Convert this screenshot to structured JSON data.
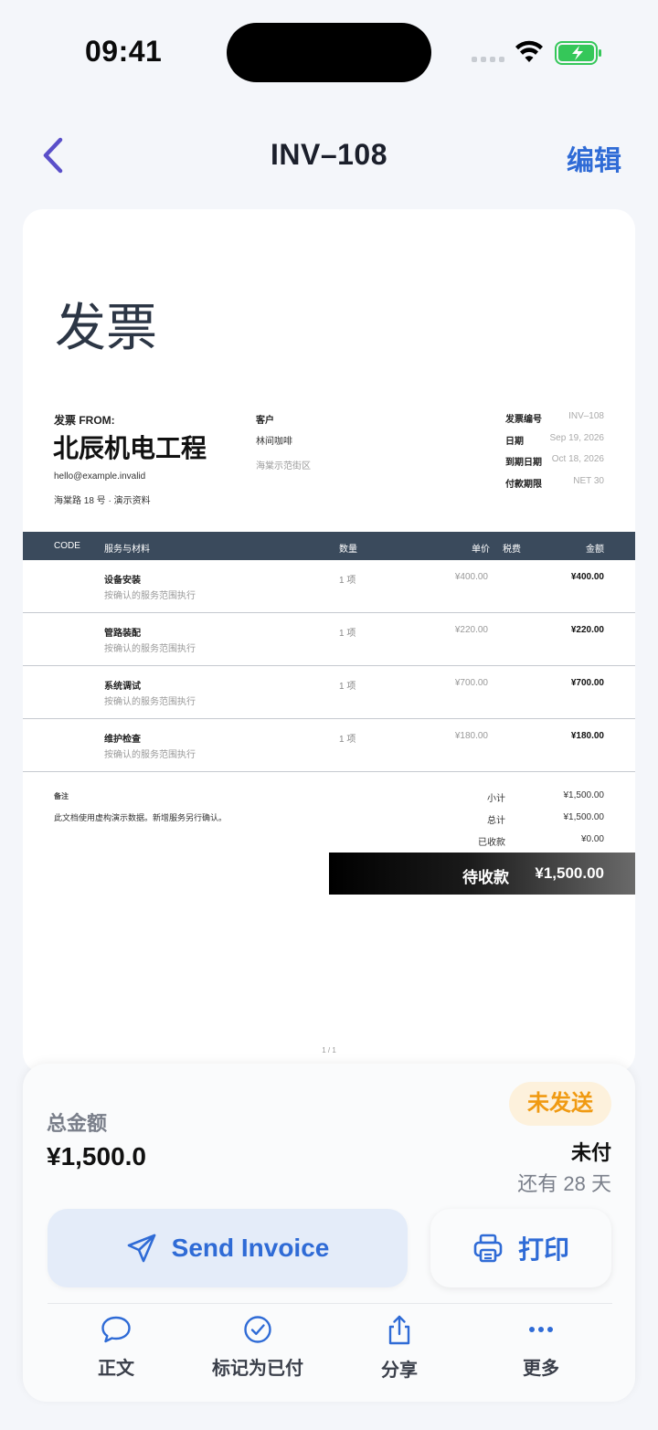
{
  "status_bar": {
    "time": "09:41"
  },
  "nav": {
    "title": "INV–108",
    "edit_label": "编辑"
  },
  "invoice": {
    "heading": "发票",
    "from_label": "发票 FROM:",
    "from_name": "北辰机电工程",
    "from_email": "hello@example.invalid",
    "from_address": "海棠路 18 号 · 演示资料",
    "client_label": "客户",
    "client_name": "林间咖啡",
    "client_address": "海棠示范街区",
    "meta": [
      {
        "key": "发票编号",
        "value": "INV–108"
      },
      {
        "key": "日期",
        "value": "Sep 19, 2026"
      },
      {
        "key": "到期日期",
        "value": "Oct 18, 2026"
      },
      {
        "key": "付款期限",
        "value": "NET 30"
      }
    ],
    "columns": {
      "code": "CODE",
      "item": "服务与材料",
      "qty": "数量",
      "price": "单价",
      "tax": "税费",
      "amount": "金额"
    },
    "items": [
      {
        "name": "设备安装",
        "sub": "按确认的服务范围执行",
        "qty": "1 项",
        "price": "¥400.00",
        "amount": "¥400.00"
      },
      {
        "name": "管路装配",
        "sub": "按确认的服务范围执行",
        "qty": "1 项",
        "price": "¥220.00",
        "amount": "¥220.00"
      },
      {
        "name": "系统调试",
        "sub": "按确认的服务范围执行",
        "qty": "1 项",
        "price": "¥700.00",
        "amount": "¥700.00"
      },
      {
        "name": "维护检查",
        "sub": "按确认的服务范围执行",
        "qty": "1 项",
        "price": "¥180.00",
        "amount": "¥180.00"
      }
    ],
    "notes_label": "备注",
    "notes_text": "此文档使用虚构演示数据。新增服务另行确认。",
    "totals": [
      {
        "key": "小计",
        "value": "¥1,500.00"
      },
      {
        "key": "总计",
        "value": "¥1,500.00"
      },
      {
        "key": "已收款",
        "value": "¥0.00"
      }
    ],
    "due_label": "待收款",
    "due_value": "¥1,500.00",
    "page_number": "1 / 1"
  },
  "summary": {
    "total_label": "总金额",
    "total_value": "¥1,500.0",
    "badge": "未发送",
    "pay_status": "未付",
    "days_left": "还有 28 天"
  },
  "actions": {
    "send": "Send Invoice",
    "print": "打印"
  },
  "tabs": [
    {
      "label": "正文",
      "icon": "chat-bubble-icon"
    },
    {
      "label": "标记为已付",
      "icon": "check-circle-icon"
    },
    {
      "label": "分享",
      "icon": "share-icon"
    },
    {
      "label": "更多",
      "icon": "more-icon"
    }
  ],
  "colors": {
    "accent": "#2f6bd6",
    "table_header": "#3a4a5c",
    "badge_bg": "#fdf1dc",
    "badge_text": "#f09a12",
    "back_chevron": "#5a4fc9"
  }
}
